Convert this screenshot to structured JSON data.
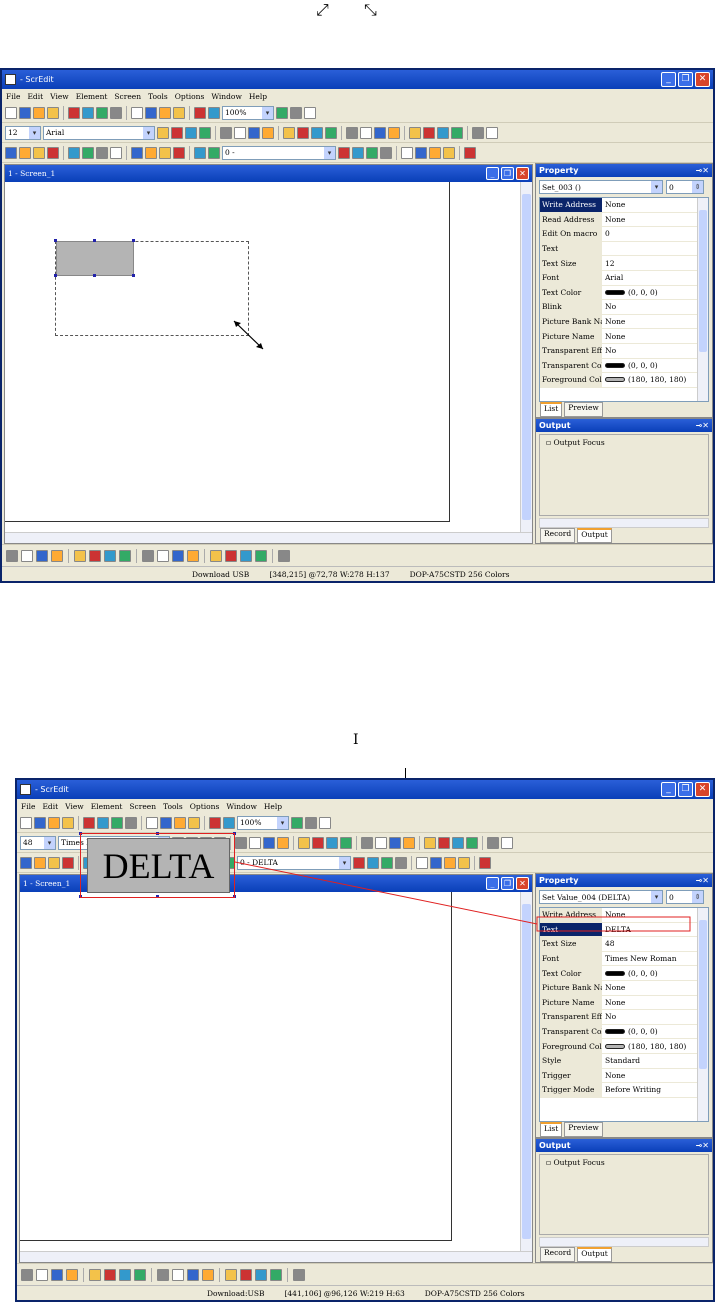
{
  "cursors": {
    "resize_a": "⤡",
    "resize_b": "⤢",
    "ibeam": "I"
  },
  "windows": [
    {
      "title": "- ScrEdit",
      "menu": [
        "File",
        "Edit",
        "View",
        "Element",
        "Screen",
        "Tools",
        "Options",
        "Window",
        "Help"
      ],
      "zoom": "100%",
      "font_size": "12",
      "font_name": "Arial",
      "state_combo": "0 -",
      "screen_title": "1 - Screen_1",
      "property_title": "Property",
      "object_select": "Set_003 ()",
      "object_index": "0",
      "properties": [
        {
          "k": "Write Address",
          "v": "None",
          "active": true
        },
        {
          "k": "Read Address",
          "v": "None"
        },
        {
          "k": "Edit On macro",
          "v": "0"
        },
        {
          "k": "Text",
          "v": ""
        },
        {
          "k": "Text Size",
          "v": "12"
        },
        {
          "k": "Font",
          "v": "Arial"
        },
        {
          "k": "Text Color",
          "v": "(0, 0, 0)",
          "swatch": "#000000"
        },
        {
          "k": "Blink",
          "v": "No"
        },
        {
          "k": "Picture Bank Name",
          "v": "None"
        },
        {
          "k": "Picture Name",
          "v": "None"
        },
        {
          "k": "Transparent Effect",
          "v": "No"
        },
        {
          "k": "Transparent Color",
          "v": "(0, 0, 0)",
          "swatch": "#000000"
        },
        {
          "k": "Foreground Color",
          "v": "(180, 180, 180)",
          "swatch": "#b4b4b4"
        }
      ],
      "prop_tabs": [
        "List",
        "Preview"
      ],
      "output_title": "Output",
      "output_item": "Output Focus",
      "output_tabs": [
        "Record",
        "Output"
      ],
      "status": [
        "Download USB",
        "[348,215] @72,78 W:278 H:137",
        "DOP-A75CSTD 256 Colors"
      ]
    },
    {
      "title": "- ScrEdit",
      "menu": [
        "File",
        "Edit",
        "View",
        "Element",
        "Screen",
        "Tools",
        "Options",
        "Window",
        "Help"
      ],
      "zoom": "100%",
      "font_size": "48",
      "font_name": "Times New Roman",
      "state_combo": "0 - DELTA",
      "screen_title": "1 - Screen_1",
      "property_title": "Property",
      "object_select": "Set Value_004 (DELTA)",
      "object_index": "0",
      "properties": [
        {
          "k": "Write Address",
          "v": "None"
        },
        {
          "k": "Text",
          "v": "DELTA",
          "active": true
        },
        {
          "k": "Text Size",
          "v": "48"
        },
        {
          "k": "Font",
          "v": "Times New Roman"
        },
        {
          "k": "Text Color",
          "v": "(0, 0, 0)",
          "swatch": "#000000"
        },
        {
          "k": "Picture Bank Name",
          "v": "None"
        },
        {
          "k": "Picture Name",
          "v": "None"
        },
        {
          "k": "Transparent Effect",
          "v": "No"
        },
        {
          "k": "Transparent Color",
          "v": "(0, 0, 0)",
          "swatch": "#000000"
        },
        {
          "k": "Foreground Color",
          "v": "(180, 180, 180)",
          "swatch": "#b4b4b4"
        },
        {
          "k": "Style",
          "v": "Standard"
        },
        {
          "k": "Trigger",
          "v": "None"
        },
        {
          "k": "Trigger Mode",
          "v": "Before Writing"
        }
      ],
      "prop_tabs": [
        "List",
        "Preview"
      ],
      "output_title": "Output",
      "output_item": "Output Focus",
      "output_tabs": [
        "Record",
        "Output"
      ],
      "status": [
        "Download:USB",
        "[441,106] @96,126 W:219 H:63",
        "DOP-A75CSTD 256 Colors"
      ],
      "element_text": "DELTA"
    }
  ]
}
